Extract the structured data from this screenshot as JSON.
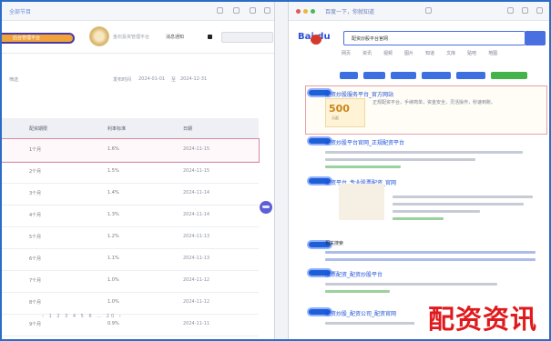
{
  "window_left": {
    "tab_title": "全部节目",
    "brand_label": "后台管理平台",
    "logo_text": "金石投资管理平台",
    "header_button": "消息通知",
    "filter_labels": [
      "筛选",
      "发布时间",
      "2024-01-01",
      "至",
      "2024-12-31"
    ],
    "table": {
      "headers": [
        "配资期限",
        "利率标准",
        "日期"
      ],
      "rows": [
        [
          "1个月",
          "1.6%",
          "2024-11-15"
        ],
        [
          "2个月",
          "1.5%",
          "2024-11-15"
        ],
        [
          "3个月",
          "1.4%",
          "2024-11-14"
        ],
        [
          "4个月",
          "1.3%",
          "2024-11-14"
        ],
        [
          "5个月",
          "1.2%",
          "2024-11-13"
        ],
        [
          "6个月",
          "1.1%",
          "2024-11-13"
        ],
        [
          "7个月",
          "1.0%",
          "2024-11-12"
        ],
        [
          "8个月",
          "1.0%",
          "2024-11-12"
        ],
        [
          "9个月",
          "0.9%",
          "2024-11-11"
        ]
      ],
      "selected_row": 0
    },
    "pager": "‹ 1 2 3 4 5 6 … 20 ›"
  },
  "window_right": {
    "tab_title": "百度一下，你就知道",
    "logo": "Bai du",
    "search_query": "配资炒股平台官网",
    "tabs": [
      "网页",
      "资讯",
      "视频",
      "图片",
      "知道",
      "文库",
      "贴吧",
      "地图"
    ],
    "ad": {
      "title": "配资炒股服务平台_官方网站",
      "price": "500",
      "price_unit": "元起",
      "desc": "正规配资平台，手续简单，资金安全，灵活操作，秒速到账。"
    },
    "results": [
      {
        "title": "配资炒股平台官网_正规配资平台"
      },
      {
        "title": "配资平台_专业股票配资_官网"
      },
      {
        "title": "股票配资_配资炒股平台"
      },
      {
        "title": "配资炒股_配资公司_配资官网"
      },
      {
        "title": "配资开户_股票配资网"
      }
    ],
    "related": "相关搜索"
  },
  "watermark_text": "配资资讯",
  "colors": {
    "frame_border": "#2a6cc8",
    "accent_blue": "#1f5fd6",
    "brand_orange": "#f1a33b",
    "watermark_red": "#e0191c"
  }
}
